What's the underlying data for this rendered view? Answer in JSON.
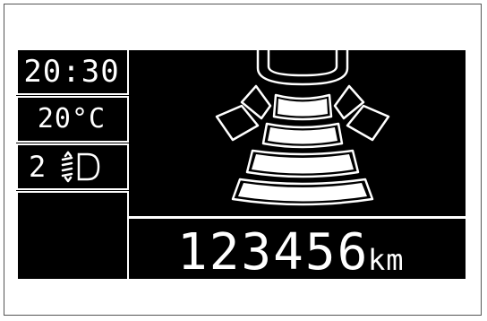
{
  "instrument_cluster": {
    "clock": "20:30",
    "temperature": "20°C",
    "headlight_level": "2",
    "headlight_icon": "headlight-beam-adjust-icon",
    "parking_sensor_icon": "parking-sensor-display-icon",
    "odometer": {
      "value": "123456",
      "unit": "km"
    }
  },
  "colors": {
    "screen_background": "#000000",
    "foreground": "#ffffff"
  }
}
